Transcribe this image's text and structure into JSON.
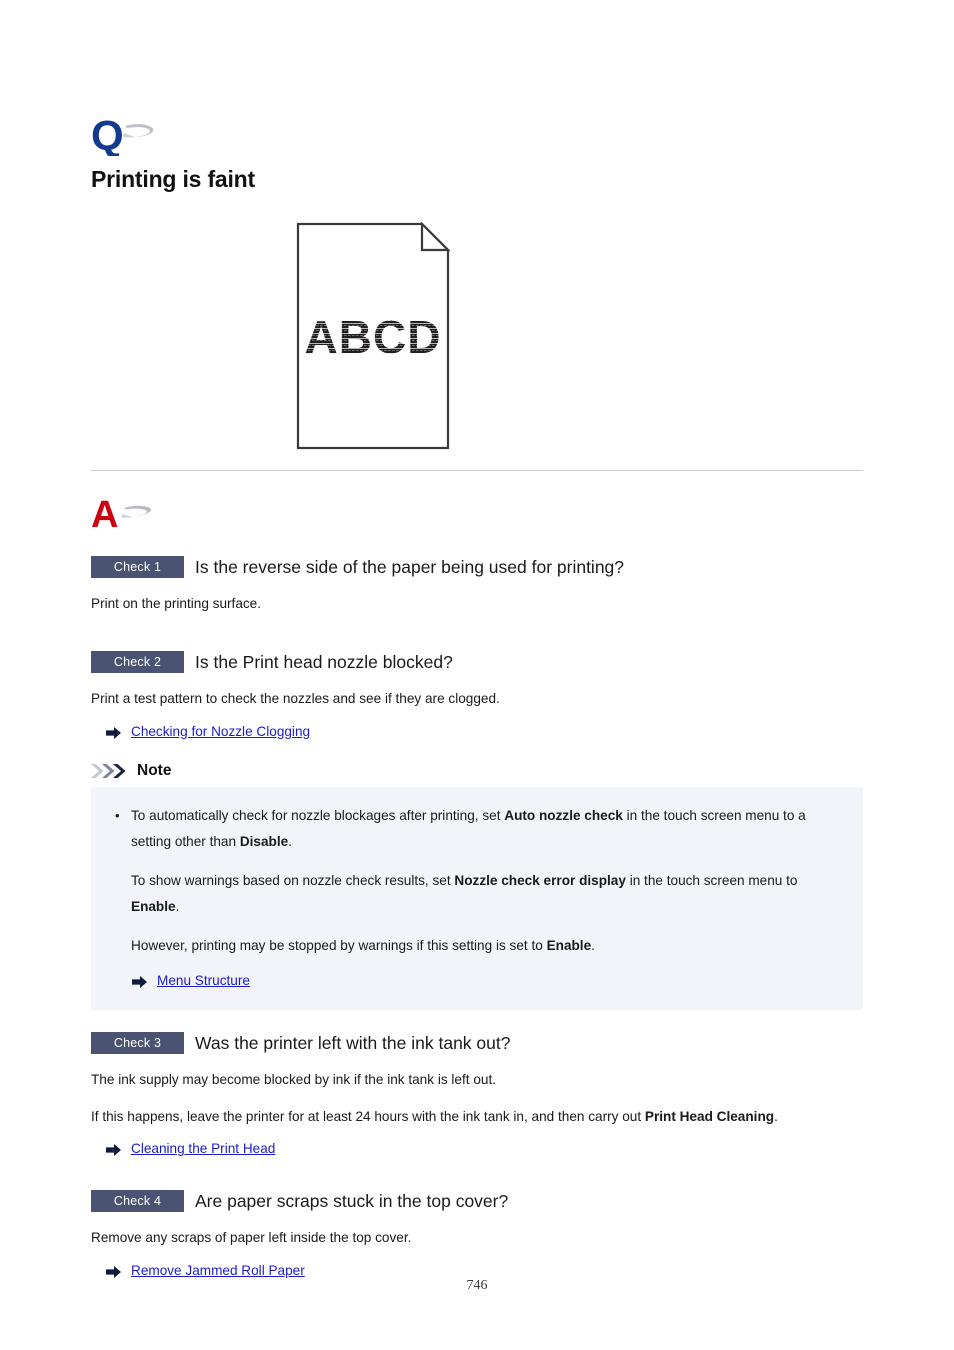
{
  "document": {
    "page_number": "746",
    "title": "Printing is faint",
    "question_icon": "q-letter-icon",
    "answer_icon": "a-letter-icon"
  },
  "illustration": {
    "name": "faint-print-sample-illustration",
    "sample_text": "ABCD",
    "description": "Sheet of paper with folded top-right corner showing faintly printed ABCD"
  },
  "checks": [
    {
      "badge": "Check 1",
      "question": "Is the reverse side of the paper being used for printing?",
      "paragraphs": [
        "Print on the printing surface."
      ],
      "links": []
    },
    {
      "badge": "Check 2",
      "question": "Is the Print head nozzle blocked?",
      "paragraphs": [
        "Print a test pattern to check the nozzles and see if they are clogged."
      ],
      "links": [
        "Checking for Nozzle Clogging"
      ]
    },
    {
      "badge": "Check 3",
      "question": "Was the printer left with the ink tank out?",
      "paragraphs": [
        "The ink supply may become blocked by ink if the ink tank is left out."
      ],
      "links": [
        "Cleaning the Print Head"
      ]
    },
    {
      "badge": "Check 4",
      "question": "Are paper scraps stuck in the top cover?",
      "paragraphs": [
        "Remove any scraps of paper left inside the top cover."
      ],
      "links": [
        "Remove Jammed Roll Paper"
      ]
    }
  ],
  "check3_rich": {
    "lead_in": "If this happens, leave the printer for at least 24 hours with the ink tank in, and then carry out ",
    "bold_term": "Print Head Cleaning",
    "trailing": "."
  },
  "note": {
    "label": "Note",
    "item1": {
      "part1": "To automatically check for nozzle blockages after printing, set ",
      "bold1": "Auto nozzle check",
      "part2": " in the touch screen menu to a setting other than ",
      "bold2": "Disable",
      "part3": "."
    },
    "item2": {
      "part1": "To show warnings based on nozzle check results, set ",
      "bold1": "Nozzle check error display",
      "part2": " in the touch screen menu to ",
      "bold2": "Enable",
      "part3": "."
    },
    "item3": {
      "part1": "However, printing may be stopped by warnings if this setting is set to ",
      "bold1": "Enable",
      "part2": "."
    },
    "link": "Menu Structure"
  },
  "colors": {
    "badge_background": "#4a5472",
    "link": "#1c1ccc",
    "note_background": "#f2f4fa",
    "q_icon": "#123a8f",
    "a_icon": "#cc0011",
    "divider": "#cfcfcf"
  }
}
